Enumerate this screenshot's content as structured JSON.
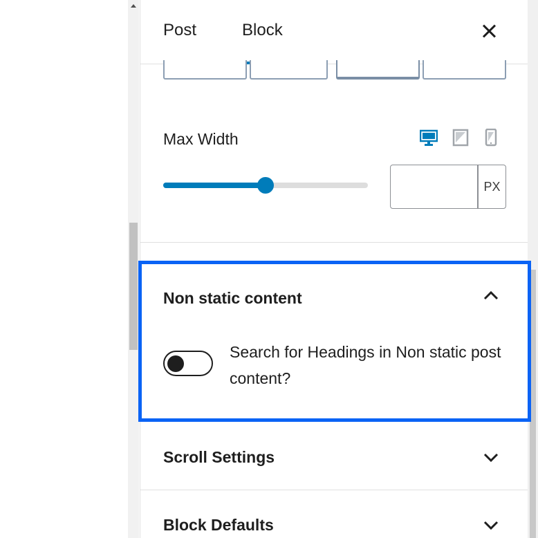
{
  "tabs": [
    {
      "label": "Post",
      "active": false
    },
    {
      "label": "Block",
      "active": true
    }
  ],
  "close_icon": "close-icon",
  "max_width": {
    "label": "Max Width",
    "devices": [
      "desktop-icon",
      "tablet-icon",
      "mobile-icon"
    ],
    "active_device": "desktop",
    "slider_level_percent": 50,
    "input_value": "",
    "unit": "PX"
  },
  "sections": {
    "non_static": {
      "title": "Non static content",
      "expanded": true,
      "toggle_label": "Search for Headings in Non static post content?",
      "toggle_on": false
    },
    "scroll": {
      "title": "Scroll Settings",
      "expanded": false
    },
    "defaults": {
      "title": "Block Defaults",
      "expanded": false
    }
  },
  "colors": {
    "accent": "#007cba",
    "highlight": "#0a63f5",
    "text": "#1e1e1e"
  }
}
